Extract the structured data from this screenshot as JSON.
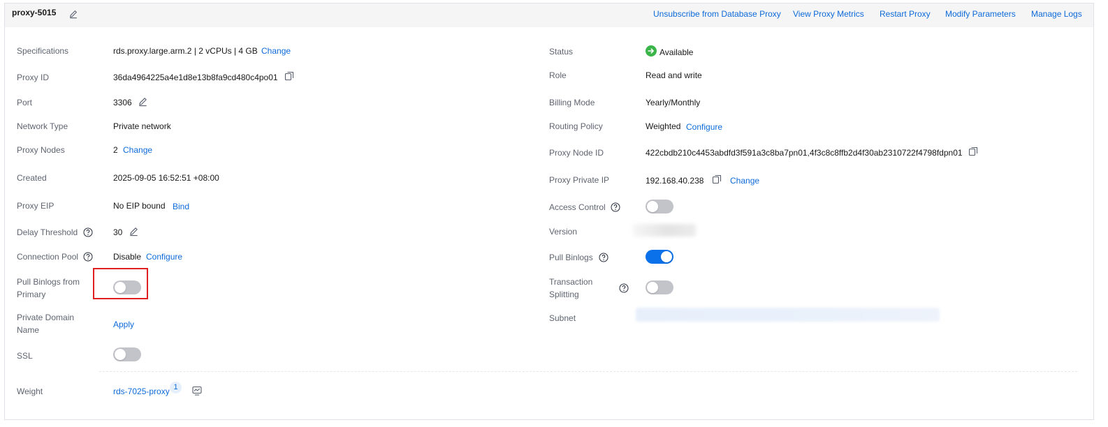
{
  "header": {
    "proxy_name": "proxy-5015",
    "actions": [
      "Unsubscribe from Database Proxy",
      "View Proxy Metrics",
      "Restart Proxy",
      "Modify Parameters",
      "Manage Logs"
    ]
  },
  "left": {
    "specifications": {
      "label": "Specifications",
      "value": "rds.proxy.large.arm.2 | 2 vCPUs | 4 GB",
      "link": "Change"
    },
    "proxy_id": {
      "label": "Proxy ID",
      "value": "36da4964225a4e1d8e13b8fa9cd480c4po01"
    },
    "port": {
      "label": "Port",
      "value": "3306"
    },
    "network_type": {
      "label": "Network Type",
      "value": "Private network"
    },
    "proxy_nodes": {
      "label": "Proxy Nodes",
      "value": "2",
      "link": "Change"
    },
    "created": {
      "label": "Created",
      "value": "2025-09-05 16:52:51 +08:00"
    },
    "proxy_eip": {
      "label": "Proxy EIP",
      "value": "No EIP bound",
      "link": "Bind"
    },
    "delay_threshold": {
      "label": "Delay Threshold",
      "value": "30"
    },
    "connection_pool": {
      "label": "Connection Pool",
      "value": "Disable",
      "link": "Configure"
    },
    "pull_binlogs_primary": {
      "label": "Pull Binlogs from Primary",
      "enabled": false
    },
    "private_domain": {
      "label": "Private Domain Name",
      "link": "Apply"
    },
    "ssl": {
      "label": "SSL",
      "enabled": false
    },
    "weight": {
      "label": "Weight",
      "link": "rds-7025-proxy",
      "count": "1"
    }
  },
  "right": {
    "status": {
      "label": "Status",
      "value": "Available",
      "color": "#3bb54a"
    },
    "role": {
      "label": "Role",
      "value": "Read and write"
    },
    "billing_mode": {
      "label": "Billing Mode",
      "value": "Yearly/Monthly"
    },
    "routing_policy": {
      "label": "Routing Policy",
      "value": "Weighted",
      "link": "Configure"
    },
    "proxy_node_id": {
      "label": "Proxy Node ID",
      "value": "422cbdb210c4453abdfd3f591a3c8ba7pn01,4f3c8c8ffb2d4f30ab2310722f4798fdpn01"
    },
    "proxy_private_ip": {
      "label": "Proxy Private IP",
      "value": "192.168.40.238",
      "link": "Change"
    },
    "access_control": {
      "label": "Access Control",
      "enabled": false
    },
    "version": {
      "label": "Version"
    },
    "pull_binlogs": {
      "label": "Pull Binlogs",
      "enabled": true
    },
    "transaction_splitting": {
      "label": "Transaction Splitting",
      "enabled": false
    },
    "subnet": {
      "label": "Subnet"
    }
  },
  "colors": {
    "link": "#0d6ad9",
    "toggle_on": "#0b71ea",
    "toggle_off": "#c2c4c9",
    "highlight": "#e02020"
  }
}
